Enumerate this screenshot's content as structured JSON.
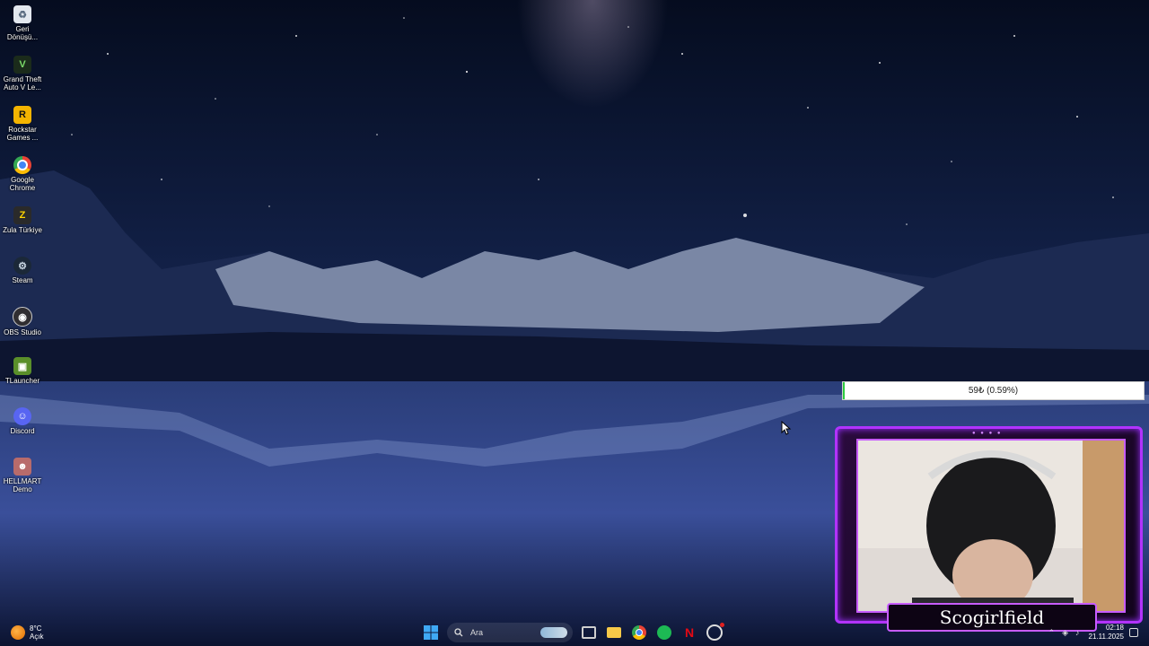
{
  "desktop": {
    "icons": [
      {
        "label": "Geri\nDönüşü...",
        "icon": "recycle-bin-icon"
      },
      {
        "label": "Grand Theft\nAuto V Le...",
        "icon": "gta-v-icon"
      },
      {
        "label": "Rockstar\nGames ...",
        "icon": "rockstar-games-icon"
      },
      {
        "label": "Google\nChrome",
        "icon": "chrome-icon"
      },
      {
        "label": "Zula Türkiye",
        "icon": "zula-icon"
      },
      {
        "label": "Steam",
        "icon": "steam-icon"
      },
      {
        "label": "OBS Studio",
        "icon": "obs-icon"
      },
      {
        "label": "TLauncher",
        "icon": "tlauncher-icon"
      },
      {
        "label": "Discord",
        "icon": "discord-icon"
      },
      {
        "label": "HELLMART\nDemo",
        "icon": "hellmart-icon"
      }
    ]
  },
  "overlay": {
    "goal_text": "59₺ (0.59%)",
    "goal_fraction": 0.0059,
    "goal_color": "#2ecc40",
    "webcam_name": "Scogirlfield",
    "frame_color": "#b233ff"
  },
  "taskbar": {
    "weather": {
      "temp": "8°C",
      "condition": "Açık"
    },
    "search_placeholder": "Ara",
    "apps": [
      "start-icon",
      "task-view-icon",
      "file-explorer-icon",
      "chrome-icon",
      "spotify-icon",
      "netflix-icon",
      "obs-icon"
    ],
    "clock": {
      "time": "02:18",
      "date": "21.11.2025"
    }
  }
}
